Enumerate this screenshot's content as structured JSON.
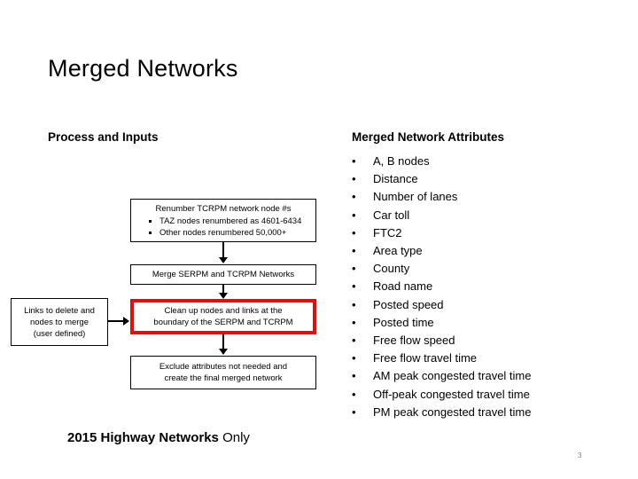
{
  "slide": {
    "title": "Merged Networks",
    "footer_note_strong": "2015 Highway Networks",
    "footer_note_light": " Only",
    "page_number": "3"
  },
  "left_column": {
    "heading": "Process and Inputs",
    "flow": {
      "renumber_box": {
        "header": "Renumber TCRPM network node #s",
        "bullets": [
          "TAZ nodes renumbered as 4601-6434",
          "Other nodes renumbered 50,000+"
        ]
      },
      "merge_box": {
        "line1": "Merge SERPM and TCRPM Networks"
      },
      "cleanup_box": {
        "line1": "Clean up nodes and links at the",
        "line2": "boundary of the SERPM and TCRPM",
        "border_color": "#dd1111"
      },
      "exclude_box": {
        "line1": "Exclude attributes not needed and",
        "line2": "create the final merged network"
      },
      "links_box": {
        "line1": "Links to delete and",
        "line2": "nodes to merge",
        "line3": "(user defined)"
      }
    }
  },
  "right_column": {
    "heading": "Merged Network Attributes",
    "attributes": [
      "A, B nodes",
      "Distance",
      "Number of lanes",
      "Car toll",
      "FTC2",
      "Area type",
      "County",
      "Road name",
      "Posted speed",
      "Posted time",
      "Free flow speed",
      "Free flow travel time",
      "AM peak congested travel time",
      "Off-peak congested travel time",
      "PM peak congested travel time"
    ]
  }
}
